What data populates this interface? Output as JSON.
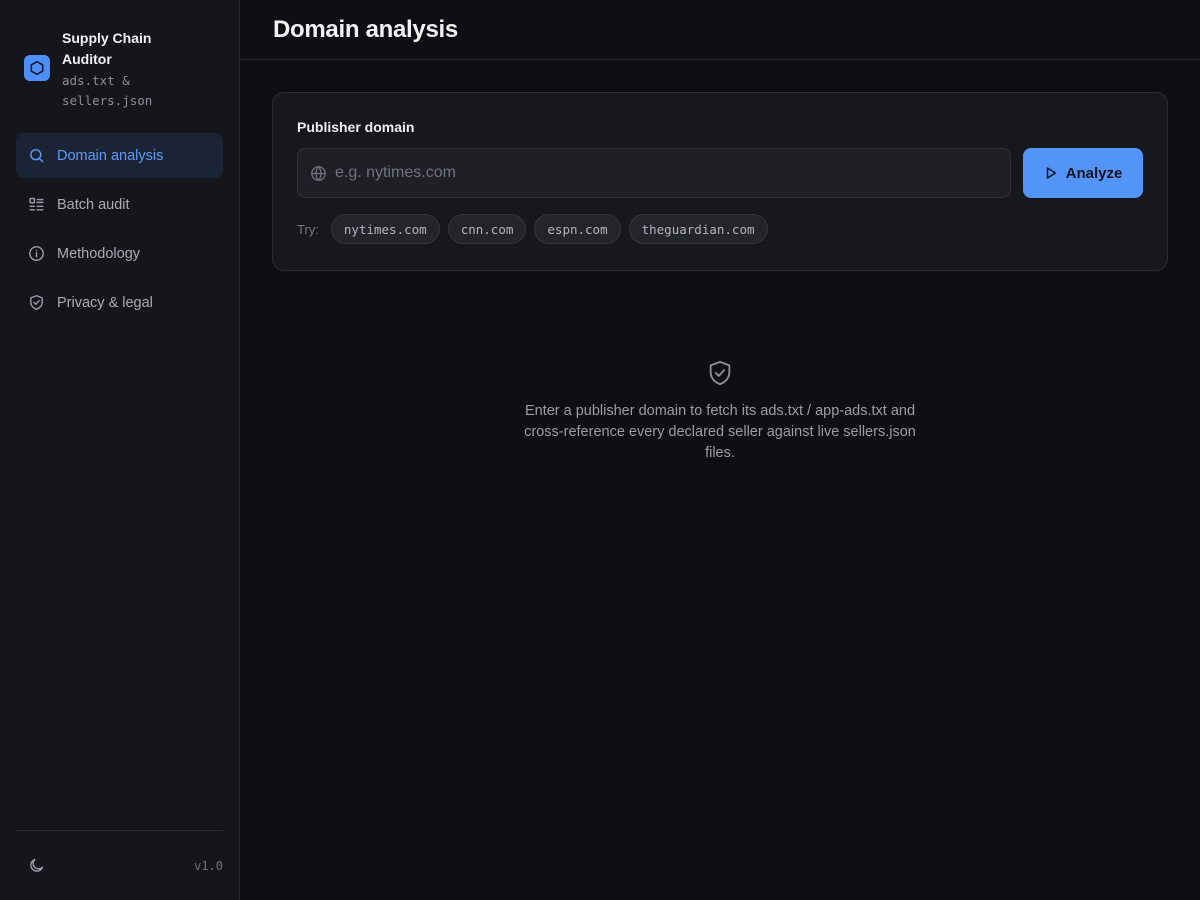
{
  "brand": {
    "title": "Supply Chain Auditor",
    "subtitle": "ads.txt & sellers.json",
    "accent": "#4f8ef7",
    "logo_icon": "hexagon-icon"
  },
  "sidebar": {
    "items": [
      {
        "label": "Domain analysis",
        "icon": "search-icon",
        "active": true
      },
      {
        "label": "Batch audit",
        "icon": "list-icon",
        "active": false
      },
      {
        "label": "Methodology",
        "icon": "info-icon",
        "active": false
      },
      {
        "label": "Privacy & legal",
        "icon": "shield-check-icon",
        "active": false
      }
    ],
    "footer": {
      "theme_icon": "moon-icon",
      "version": "v1.0"
    }
  },
  "header": {
    "title": "Domain analysis"
  },
  "form": {
    "label": "Publisher domain",
    "input_value": "",
    "placeholder": "e.g. nytimes.com",
    "input_icon": "globe-icon",
    "button_label": "Analyze",
    "button_icon": "play-icon",
    "try_label": "Try:",
    "suggestions": [
      "nytimes.com",
      "cnn.com",
      "espn.com",
      "theguardian.com"
    ]
  },
  "empty_state": {
    "icon": "shield-check-icon",
    "text": "Enter a publisher domain to fetch its ads.txt / app-ads.txt and cross-reference every declared seller against live sellers.json files."
  },
  "colors": {
    "background": "#0e0f12",
    "sidebar": "#15161b",
    "active_nav_bg": "#1b2434",
    "active_nav_text": "#5c9bff",
    "button": "#5294f8"
  }
}
